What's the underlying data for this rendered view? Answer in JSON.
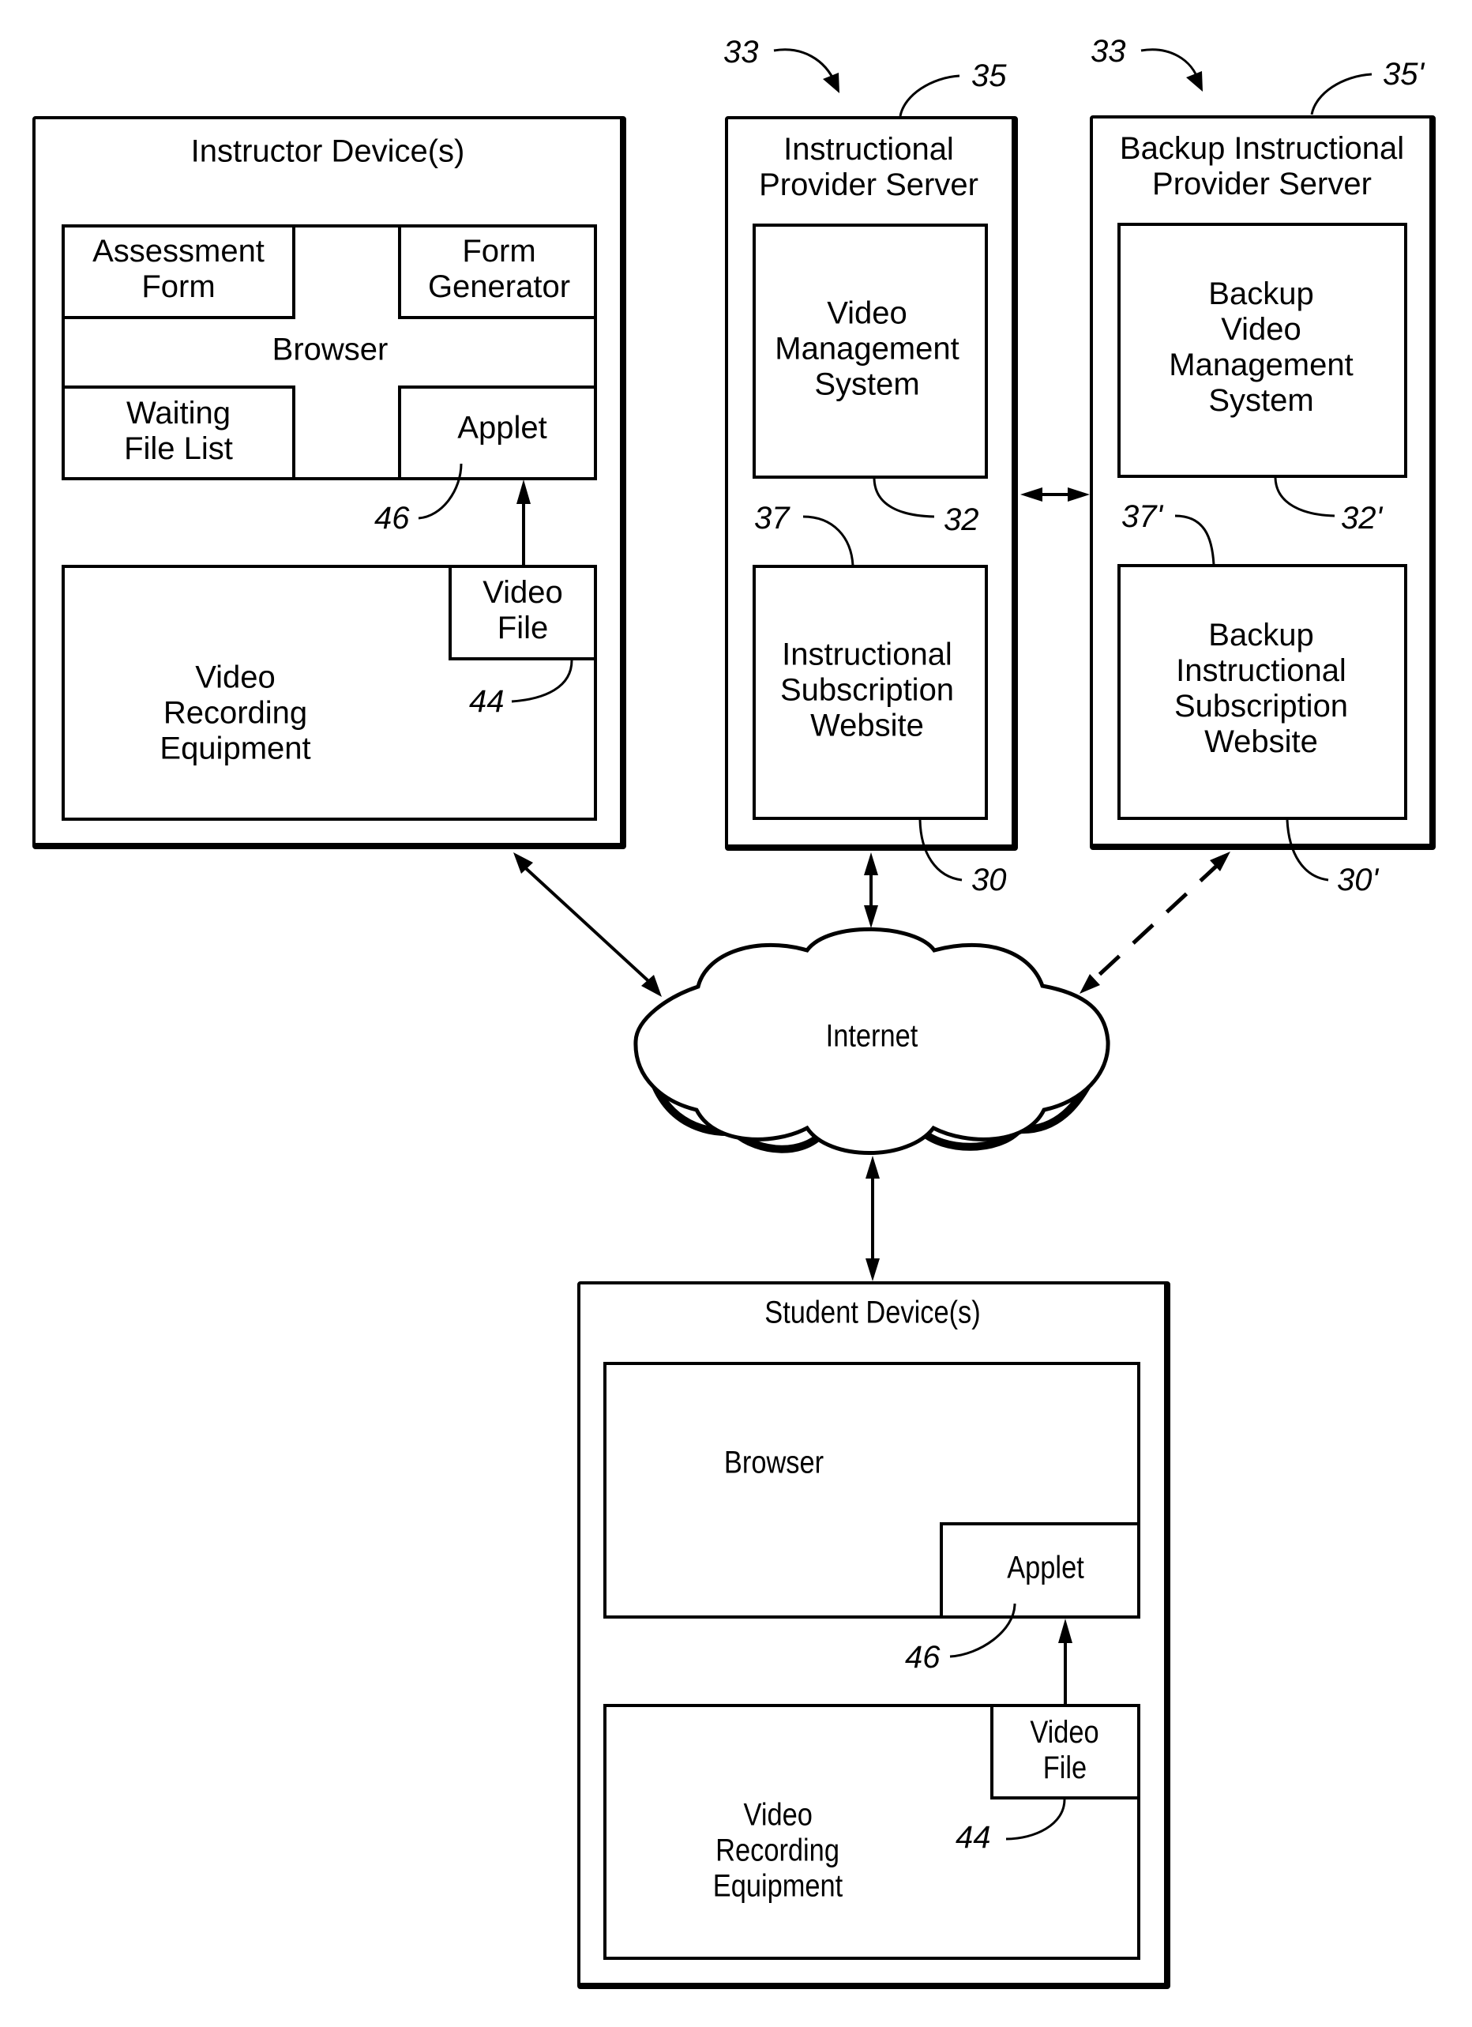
{
  "figure": {
    "instructor_device": {
      "title": "Instructor Device(s)",
      "assessment_form": [
        "Assessment",
        "Form"
      ],
      "form_generator": [
        "Form",
        "Generator"
      ],
      "browser": "Browser",
      "waiting_file_list": [
        "Waiting",
        "File List"
      ],
      "applet": "Applet",
      "video_recording_equipment": [
        "Video",
        "Recording",
        "Equipment"
      ],
      "video_file": [
        "Video",
        "File"
      ],
      "ref_applet": "46",
      "ref_video_file": "44"
    },
    "provider_server": {
      "title": [
        "Instructional",
        "Provider Server"
      ],
      "video_management_system": [
        "Video",
        "Management",
        "System"
      ],
      "subscription_website": [
        "Instructional",
        "Subscription",
        "Website"
      ],
      "ref_group": "33",
      "ref_server": "35",
      "ref_vms": "32",
      "ref_website_link": "37",
      "ref_website": "30"
    },
    "backup_server": {
      "title": [
        "Backup Instructional",
        "Provider Server"
      ],
      "video_management_system": [
        "Backup",
        "Video",
        "Management",
        "System"
      ],
      "subscription_website": [
        "Backup",
        "Instructional",
        "Subscription",
        "Website"
      ],
      "ref_group": "33",
      "ref_server": "35'",
      "ref_vms": "32'",
      "ref_website_link": "37'",
      "ref_website": "30'"
    },
    "network": {
      "label": "Internet"
    },
    "student_device": {
      "title": "Student Device(s)",
      "browser": "Browser",
      "applet": "Applet",
      "video_recording_equipment": [
        "Video",
        "Recording",
        "Equipment"
      ],
      "video_file": [
        "Video",
        "File"
      ],
      "ref_applet": "46",
      "ref_video_file": "44"
    },
    "connections": [
      {
        "from": "Instructor Device(s)",
        "to": "Internet",
        "style": "solid",
        "direction": "bidirectional"
      },
      {
        "from": "Instructional Provider Server",
        "to": "Internet",
        "style": "solid",
        "direction": "bidirectional"
      },
      {
        "from": "Backup Instructional Provider Server",
        "to": "Internet",
        "style": "dashed",
        "direction": "bidirectional"
      },
      {
        "from": "Instructional Provider Server",
        "to": "Backup Instructional Provider Server",
        "style": "solid",
        "direction": "bidirectional"
      },
      {
        "from": "Internet",
        "to": "Student Device(s)",
        "style": "solid",
        "direction": "bidirectional"
      },
      {
        "from": "Video File",
        "to": "Applet",
        "style": "solid",
        "direction": "forward"
      }
    ]
  }
}
